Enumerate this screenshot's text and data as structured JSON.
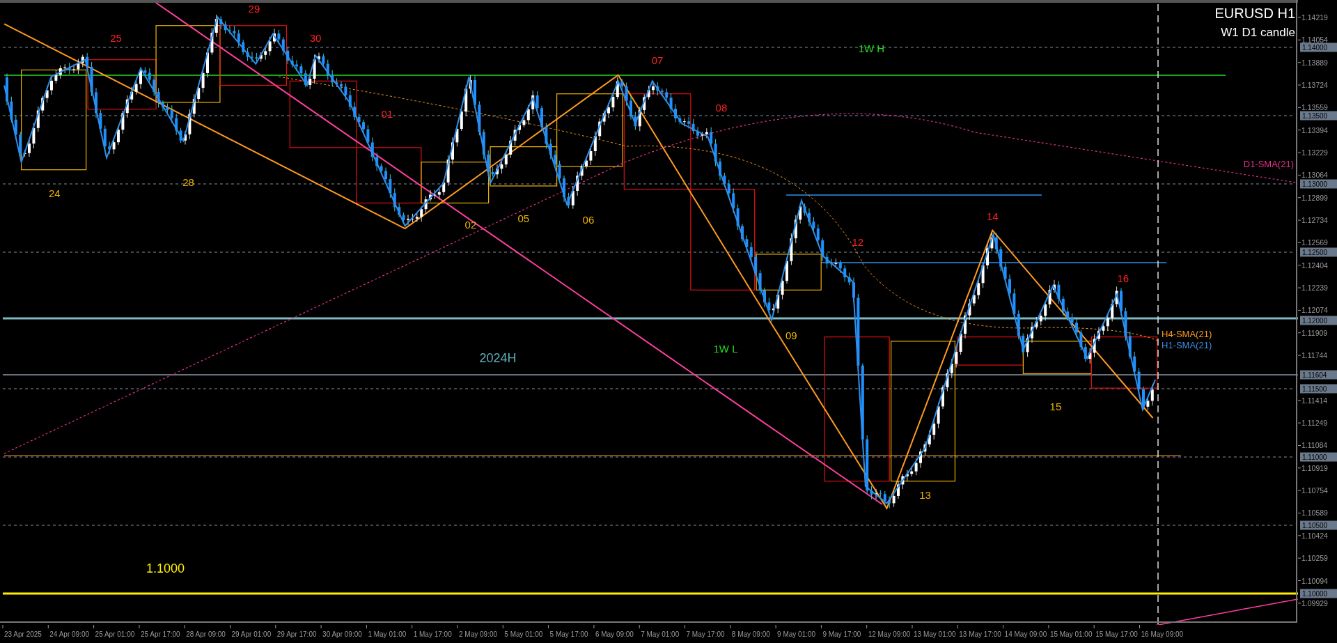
{
  "chart": {
    "symbol": "EURUSD H1",
    "subtitle": "W1 D1 candle",
    "price_ticks": [
      "1.14219",
      "1.14054",
      "1.13889",
      "1.13724",
      "1.13559",
      "1.13394",
      "1.13229",
      "1.13064",
      "1.12899",
      "1.12734",
      "1.12569",
      "1.12404",
      "1.12239",
      "1.12074",
      "1.11909",
      "1.11744",
      "1.11414",
      "1.11249",
      "1.11084",
      "1.10919",
      "1.10754",
      "1.10589",
      "1.10424",
      "1.10259",
      "1.10094",
      "1.09929"
    ],
    "price_badges": [
      "1.14000",
      "1.13500",
      "1.13000",
      "1.12500",
      "1.12000",
      "1.11604",
      "1.11500",
      "1.11000",
      "1.10500",
      "1.10000"
    ],
    "time_labels": [
      "23 Apr 2025",
      "24 Apr 09:00",
      "25 Apr 01:00",
      "25 Apr 17:00",
      "28 Apr 09:00",
      "29 Apr 01:00",
      "29 Apr 17:00",
      "30 Apr 09:00",
      "1 May 01:00",
      "1 May 17:00",
      "2 May 09:00",
      "5 May 01:00",
      "5 May 17:00",
      "6 May 09:00",
      "7 May 01:00",
      "7 May 17:00",
      "8 May 09:00",
      "9 May 01:00",
      "9 May 17:00",
      "12 May 09:00",
      "13 May 01:00",
      "13 May 17:00",
      "14 May 09:00",
      "15 May 01:00",
      "15 May 17:00",
      "16 May 09:00"
    ],
    "day_labels": [
      {
        "text": "24",
        "kind": "low"
      },
      {
        "text": "25",
        "kind": "high"
      },
      {
        "text": "28",
        "kind": "low"
      },
      {
        "text": "29",
        "kind": "high"
      },
      {
        "text": "30",
        "kind": "high"
      },
      {
        "text": "01",
        "kind": "high"
      },
      {
        "text": "02",
        "kind": "low"
      },
      {
        "text": "05",
        "kind": "low"
      },
      {
        "text": "06",
        "kind": "low"
      },
      {
        "text": "07",
        "kind": "high"
      },
      {
        "text": "08",
        "kind": "high"
      },
      {
        "text": "09",
        "kind": "low"
      },
      {
        "text": "12",
        "kind": "high"
      },
      {
        "text": "13",
        "kind": "low"
      },
      {
        "text": "14",
        "kind": "high"
      },
      {
        "text": "15",
        "kind": "low"
      },
      {
        "text": "16",
        "kind": "high"
      }
    ],
    "level_labels": [
      {
        "text": "1W H",
        "kind": "weekly"
      },
      {
        "text": "2024H",
        "kind": "yearly"
      },
      {
        "text": "1W L",
        "kind": "weekly"
      },
      {
        "text": "1.1000",
        "kind": "round"
      }
    ],
    "indicator_labels": [
      {
        "text": "D1-SMA(21)",
        "kind": "d1"
      },
      {
        "text": "H4-SMA(21)",
        "kind": "h4"
      },
      {
        "text": "H1-SMA(21)",
        "kind": "h1"
      }
    ]
  }
}
